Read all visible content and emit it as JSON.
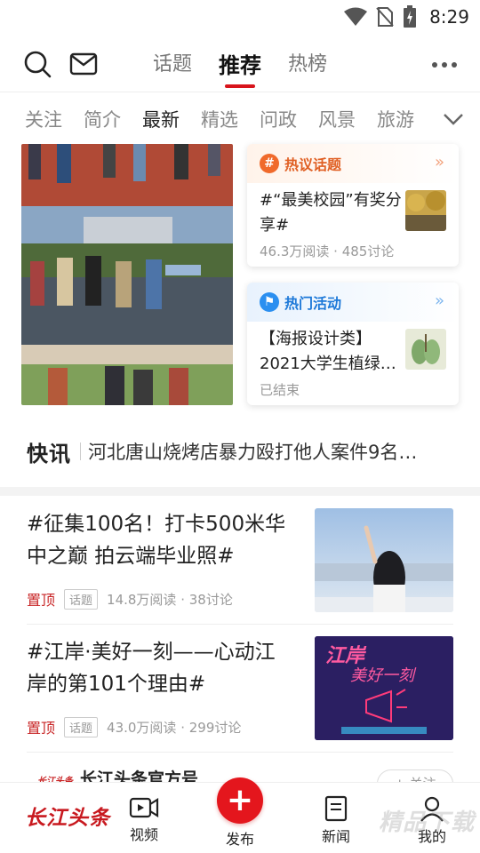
{
  "status_bar": {
    "time": "8:29"
  },
  "header": {
    "tabs": [
      {
        "label": "话题",
        "active": false
      },
      {
        "label": "推荐",
        "active": true
      },
      {
        "label": "热榜",
        "active": false
      }
    ]
  },
  "categories": [
    {
      "label": "关注",
      "active": false
    },
    {
      "label": "简介",
      "active": false
    },
    {
      "label": "最新",
      "active": true
    },
    {
      "label": "精选",
      "active": false
    },
    {
      "label": "问政",
      "active": false
    },
    {
      "label": "风景",
      "active": false
    },
    {
      "label": "旅游",
      "active": false
    }
  ],
  "hot_topic_card": {
    "title": "热议话题",
    "text": "#“最美校园”有奖分享#",
    "meta": "46.3万阅读 · 485讨论",
    "accent": "#f06a2b"
  },
  "hot_event_card": {
    "title": "热门活动",
    "text": "【海报设计类】2021大学生植绿…",
    "meta": "已结束",
    "accent": "#2b8ff0"
  },
  "flash": {
    "label": "快讯",
    "text": "河北唐山烧烤店暴力殴打他人案件9名…"
  },
  "articles": [
    {
      "title": "#征集100名！打卡500米华中之巅  拍云端毕业照#",
      "pin": "置顶",
      "tag": "话题",
      "meta": "14.8万阅读 · 38讨论"
    },
    {
      "title": "#江岸·美好一刻——心动江岸的第101个理由#",
      "pin": "置顶",
      "tag": "话题",
      "meta": "43.0万阅读 · 299讨论",
      "thumb_text": "江岸",
      "thumb_text2": "美好一刻"
    }
  ],
  "account": {
    "logo": "长江头条",
    "name": "长江头条官方号",
    "follow": "+ 关注"
  },
  "bottom_nav": {
    "brand": "长江头条",
    "video": "视频",
    "publish": "发布",
    "news": "新闻",
    "mine": "我的",
    "watermark": "精品下载"
  },
  "colors": {
    "brand_red": "#d8141c"
  }
}
